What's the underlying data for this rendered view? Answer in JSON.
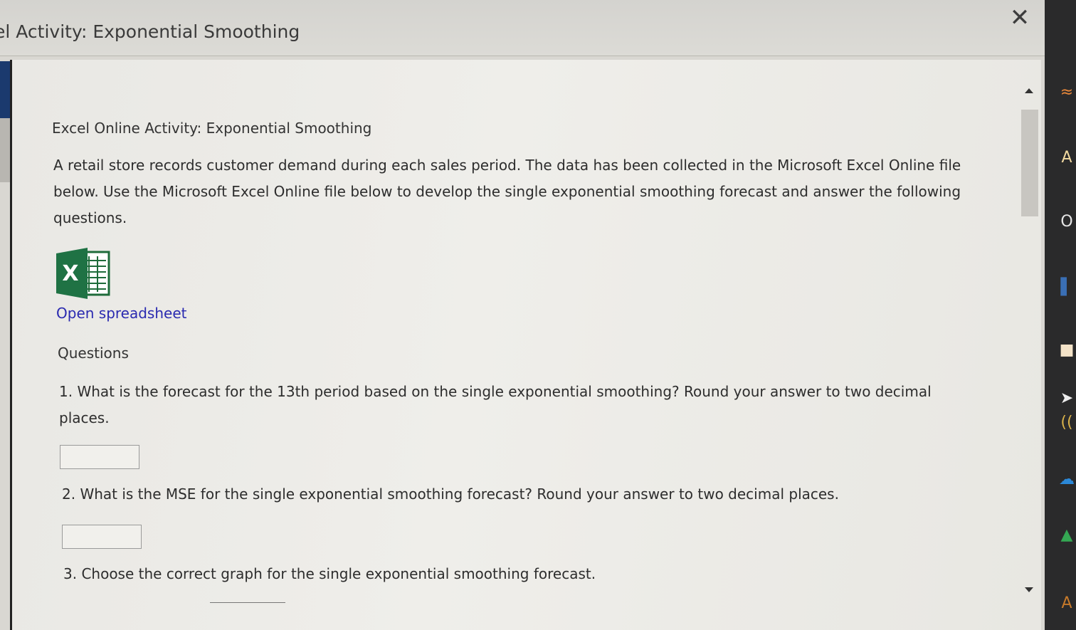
{
  "window": {
    "title": "el Activity: Exponential Smoothing",
    "close_label": "✕"
  },
  "main": {
    "heading": "Excel Online Activity: Exponential Smoothing",
    "description": "A retail store records customer demand during each sales period. The data has been collected in the Microsoft Excel Online file below. Use the Microsoft Excel Online file below to develop the single exponential smoothing forecast and answer the following questions.",
    "excel_icon_letter": "X",
    "open_link": "Open spreadsheet",
    "questions_heading": "Questions",
    "questions": [
      {
        "text": "1. What is the forecast for the 13th period based on the single exponential smoothing? Round your answer to two decimal places.",
        "answer": ""
      },
      {
        "text": "2. What is the MSE for the single exponential smoothing forecast? Round your answer to two decimal places.",
        "answer": ""
      },
      {
        "text": "3. Choose the correct graph for the single exponential smoothing forecast.",
        "selected": ""
      }
    ]
  },
  "taskbar": {
    "icons": [
      {
        "name": "rss-icon",
        "glyph": "≈",
        "color": "#e8873a"
      },
      {
        "name": "font-app-icon",
        "glyph": "A",
        "color": "#f1d9a0"
      },
      {
        "name": "office-icon",
        "glyph": "O",
        "color": "#e6e6e6"
      },
      {
        "name": "book-icon",
        "glyph": "▌",
        "color": "#3a6fb5"
      },
      {
        "name": "bookmark-icon",
        "glyph": "■",
        "color": "#f4e3c8"
      },
      {
        "name": "cursor-icon",
        "glyph": "➤",
        "color": "#eeeeee"
      },
      {
        "name": "wifi-icon",
        "glyph": "((",
        "color": "#d9b24a"
      },
      {
        "name": "onedrive-icon",
        "glyph": "☁",
        "color": "#2b88d8"
      },
      {
        "name": "google-drive-icon",
        "glyph": "▲",
        "color": "#34a853"
      },
      {
        "name": "app-a-icon",
        "glyph": "A",
        "color": "#c77a2a"
      }
    ]
  }
}
